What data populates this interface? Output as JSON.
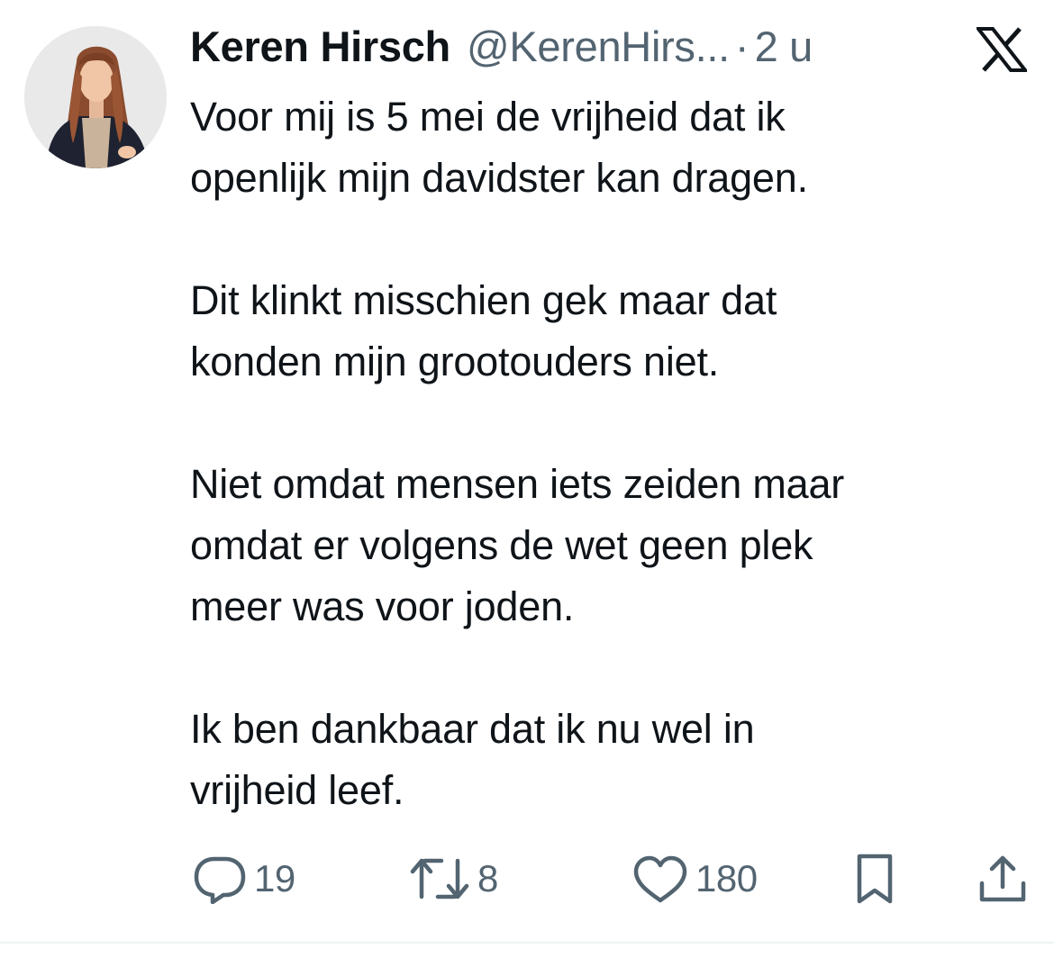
{
  "tweet": {
    "author": {
      "display_name": "Keren Hirsch",
      "handle": "@KerenHirs...",
      "avatar_icon": "profile-photo"
    },
    "separator": "·",
    "time": "2 u",
    "platform_icon": "x-logo-icon",
    "paragraphs": [
      "Voor mij is 5 mei de vrijheid dat ik\nopenlijk mijn davidster kan dragen.",
      "Dit klinkt misschien gek maar dat\nkonden mijn grootouders niet.",
      "Niet omdat mensen iets zeiden maar\nomdat er volgens de wet geen plek\nmeer was voor joden.",
      "Ik ben dankbaar dat ik nu wel in\nvrijheid leef."
    ],
    "actions": {
      "replies": {
        "icon": "reply-icon",
        "count": "19"
      },
      "reposts": {
        "icon": "repost-icon",
        "count": "8"
      },
      "likes": {
        "icon": "heart-icon",
        "count": "180"
      },
      "bookmark": {
        "icon": "bookmark-icon"
      },
      "share": {
        "icon": "share-icon"
      }
    }
  },
  "colors": {
    "text_primary": "#0f1419",
    "text_secondary": "#536471",
    "background": "#ffffff",
    "divider": "#eff3f4"
  }
}
